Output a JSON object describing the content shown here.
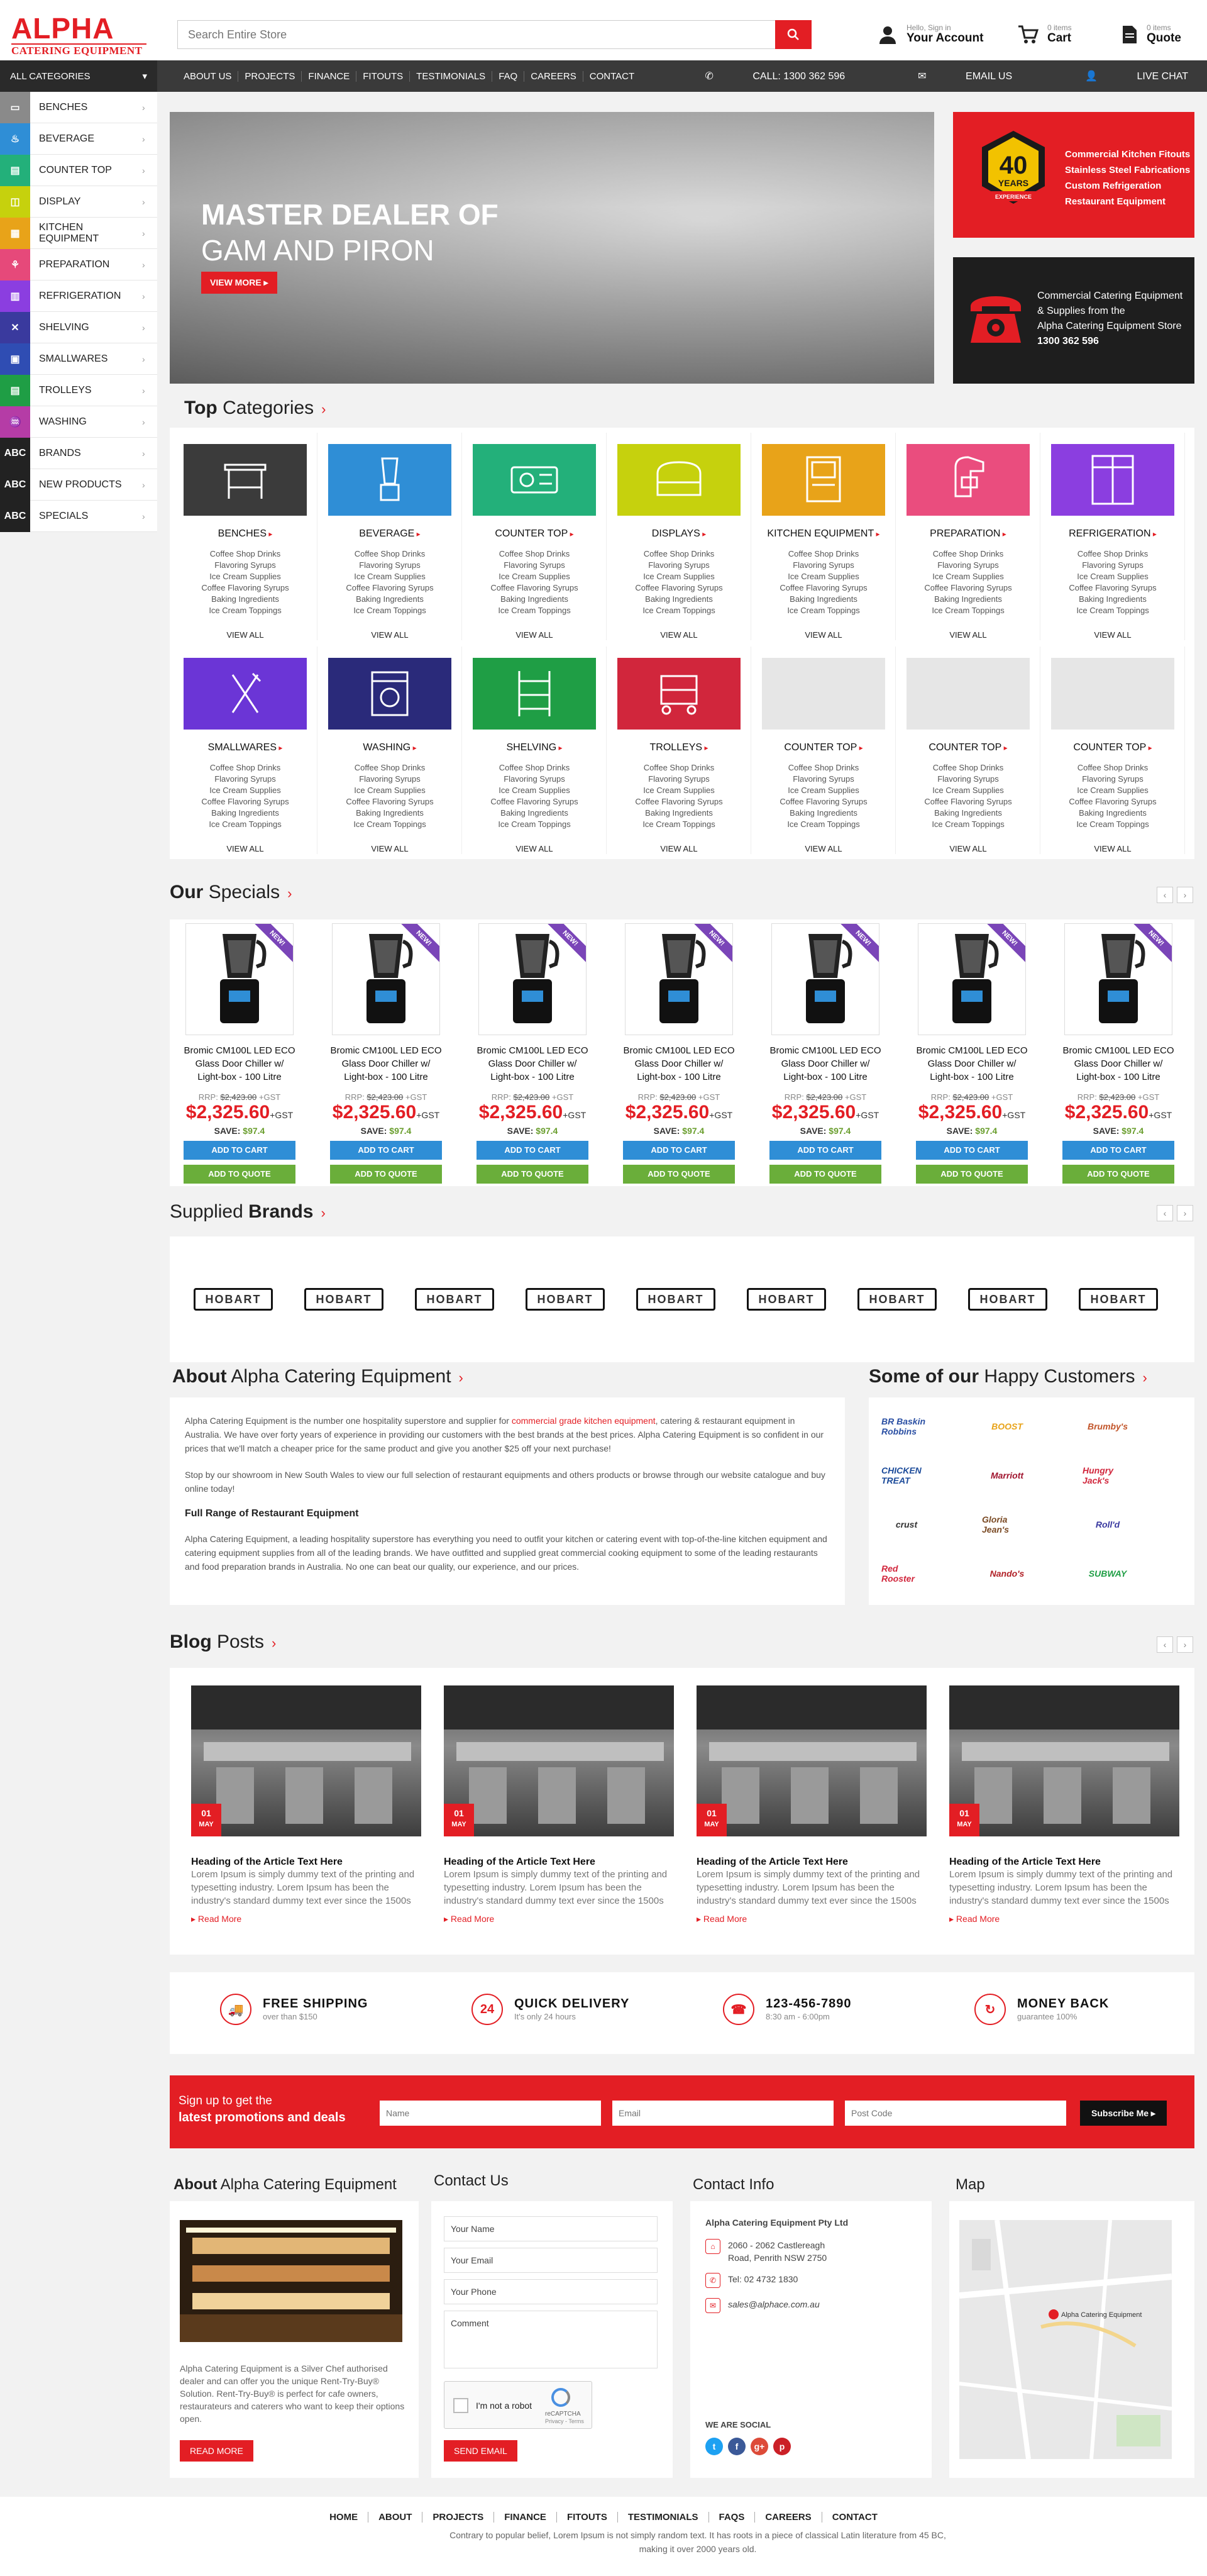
{
  "header": {
    "logo_top": "ALPHA",
    "logo_bottom": "CATERING EQUIPMENT",
    "search_placeholder": "Search Entire Store",
    "account_small": "Hello, Sign in",
    "account_label": "Your Account",
    "cart_small": "0 items",
    "cart_label": "Cart",
    "quote_small": "0 items",
    "quote_label": "Quote"
  },
  "nav": {
    "all_categories": "ALL CATEGORIES",
    "menu": [
      "ABOUT US",
      "PROJECTS",
      "FINANCE",
      "FITOUTS",
      "TESTIMONIALS",
      "FAQ",
      "CAREERS",
      "CONTACT"
    ],
    "call": "CALL: 1300 362 596",
    "email": "EMAIL US",
    "chat": "LIVE CHAT"
  },
  "sidebar": [
    {
      "label": "BENCHES",
      "color": "#8a8a8a",
      "icon": "bench-icon",
      "glyph": "▭"
    },
    {
      "label": "BEVERAGE",
      "color": "#2f8ed6",
      "icon": "beverage-icon",
      "glyph": "♨"
    },
    {
      "label": "COUNTER TOP",
      "color": "#23b07a",
      "icon": "counter-top-icon",
      "glyph": "▤"
    },
    {
      "label": "DISPLAY",
      "color": "#c6d10d",
      "icon": "display-icon",
      "glyph": "◫"
    },
    {
      "label": "KITCHEN EQUIPMENT",
      "color": "#e8a319",
      "icon": "kitchen-equipment-icon",
      "glyph": "▦"
    },
    {
      "label": "PREPARATION",
      "color": "#e6497a",
      "icon": "preparation-icon",
      "glyph": "⚘"
    },
    {
      "label": "REFRIGERATION",
      "color": "#8b3ee0",
      "icon": "refrigeration-icon",
      "glyph": "▥"
    },
    {
      "label": "SHELVING",
      "color": "#3a3a9e",
      "icon": "shelving-icon",
      "glyph": "✕"
    },
    {
      "label": "SMALLWARES",
      "color": "#2f4db3",
      "icon": "smallwares-icon",
      "glyph": "▣"
    },
    {
      "label": "TROLLEYS",
      "color": "#1f9e45",
      "icon": "trolleys-icon",
      "glyph": "▤"
    },
    {
      "label": "WASHING",
      "color": "#b53ca6",
      "icon": "washing-icon",
      "glyph": "♒"
    },
    {
      "label": "BRANDS",
      "color": "#222222",
      "icon": "brands-icon",
      "glyph": "ABC"
    },
    {
      "label": "NEW PRODUCTS",
      "color": "#222222",
      "icon": "new-products-icon",
      "glyph": "ABC"
    },
    {
      "label": "SPECIALS",
      "color": "#222222",
      "icon": "specials-icon",
      "glyph": "ABC"
    }
  ],
  "hero": {
    "line1": "MASTER DEALER OF",
    "line2": "GAM AND PIRON",
    "button": "VIEW MORE ▸"
  },
  "promo1": {
    "badge_num": "40",
    "badge_text": "YEARS",
    "badge_sub": "EXPERIENCE",
    "items": [
      "Commercial Kitchen Fitouts",
      "Stainless Steel Fabrications",
      "Custom Refrigeration",
      "Restaurant Equipment"
    ]
  },
  "promo2": {
    "line1": "Commercial Catering Equipment",
    "line2": "& Supplies from the",
    "line3": "Alpha Catering Equipment Store",
    "phone": "1300 362 596"
  },
  "top_categories": {
    "title_bold": "Top",
    "title_rest": "Categories",
    "sub_items": [
      "Coffee Shop Drinks",
      "Flavoring Syrups",
      "Ice Cream Supplies",
      "Coffee Flavoring Syrups",
      "Baking Ingredients",
      "Ice Cream Toppings"
    ],
    "view_all": "VIEW ALL",
    "items": [
      {
        "name": "BENCHES",
        "color": "#3b3b3b",
        "icon": "bench-icon"
      },
      {
        "name": "BEVERAGE",
        "color": "#2f8ed6",
        "icon": "blender-icon"
      },
      {
        "name": "COUNTER TOP",
        "color": "#23b07a",
        "icon": "counter-top-icon"
      },
      {
        "name": "DISPLAYS",
        "color": "#c6d10d",
        "icon": "display-case-icon"
      },
      {
        "name": "KITCHEN EQUIPMENT",
        "color": "#e8a319",
        "icon": "kitchen-equipment-icon"
      },
      {
        "name": "PREPARATION",
        "color": "#ea4d7e",
        "icon": "mixer-icon"
      },
      {
        "name": "REFRIGERATION",
        "color": "#8b3ee0",
        "icon": "fridge-icon"
      },
      {
        "name": "SMALLWARES",
        "color": "#6b35d6",
        "icon": "fork-knife-icon"
      },
      {
        "name": "WASHING",
        "color": "#2a2a7a",
        "icon": "dishwasher-icon"
      },
      {
        "name": "SHELVING",
        "color": "#1f9e45",
        "icon": "shelving-icon"
      },
      {
        "name": "TROLLEYS",
        "color": "#d1263c",
        "icon": "trolley-icon"
      },
      {
        "name": "COUNTER TOP",
        "color": "#e6e6e6",
        "icon": "placeholder-icon"
      },
      {
        "name": "COUNTER TOP",
        "color": "#e6e6e6",
        "icon": "placeholder-icon"
      },
      {
        "name": "COUNTER TOP",
        "color": "#e6e6e6",
        "icon": "placeholder-icon"
      }
    ]
  },
  "specials": {
    "title_bold": "Our",
    "title_rest": "Specials",
    "product": {
      "badge": "NEW!",
      "name": "Bromic CM100L LED ECO Glass Door Chiller w/ Light-box - 100 Litre",
      "rrp_label": "RRP:",
      "rrp": "$2,423.00",
      "rrp_gst": "+GST",
      "price": "$2,325.60",
      "price_gst": "+GST",
      "save_label": "SAVE:",
      "save": "$97.4",
      "add_cart": "ADD TO CART",
      "add_quote": "ADD TO QUOTE"
    },
    "count": 7
  },
  "brands": {
    "title_rest": "Supplied",
    "title_bold": "Brands",
    "logo": "HOBART",
    "count": 9
  },
  "about": {
    "title_bold": "About",
    "title_rest": "Alpha Catering Equipment",
    "p1_a": "Alpha Catering Equipment is the number one hospitality superstore and supplier for ",
    "p1_link": "commercial grade kitchen equipment",
    "p1_b": ", catering & restaurant equipment  in Australia. We have over forty years of experience in providing our customers with the best brands at the best prices. Alpha Catering Equipment is so confident in our prices that we'll match a cheaper price for the same product and give you another $25 off your next purchase!",
    "p2": "Stop by our showroom in New South Wales to view our full selection of restaurant equipments and others products or browse through our website catalogue and buy online today!",
    "h": "Full Range of Restaurant Equipment",
    "p3": "Alpha Catering Equipment, a leading hospitality superstore has everything you need to outfit your kitchen or catering event with top-of-the-line kitchen equipment and catering equipment supplies from all of the leading brands. We have outfitted and supplied great commercial cooking equipment to some of the leading restaurants and food preparation brands in Australia. No one can beat our quality, our experience, and our prices."
  },
  "customers": {
    "title_rest1": "Some of our",
    "title_rest2": "Happy Customers",
    "logos": [
      {
        "text": "BR Baskin Robbins",
        "color": "#2a4fa3"
      },
      {
        "text": "BOOST",
        "color": "#e8a319"
      },
      {
        "text": "Brumby's",
        "color": "#c2552a"
      },
      {
        "text": "CHICKEN TREAT",
        "color": "#1c4b9a"
      },
      {
        "text": "Marriott",
        "color": "#a0142e"
      },
      {
        "text": "Hungry Jack's",
        "color": "#d1263c"
      },
      {
        "text": "crust",
        "color": "#333333"
      },
      {
        "text": "Gloria Jean's",
        "color": "#7a4a24"
      },
      {
        "text": "Roll'd",
        "color": "#3a3aa0"
      },
      {
        "text": "Red Rooster",
        "color": "#d1263c"
      },
      {
        "text": "Nando's",
        "color": "#b01e24"
      },
      {
        "text": "SUBWAY",
        "color": "#1f9e45"
      }
    ]
  },
  "blog": {
    "title_bold": "Blog",
    "title_rest": "Posts",
    "post": {
      "day": "01",
      "month": "MAY",
      "heading": "Heading of the Article Text Here",
      "body": "Lorem Ipsum is simply dummy text of the printing and typesetting industry. Lorem Ipsum has been the industry's standard dummy text ever since the 1500s",
      "more": "▸  Read More"
    },
    "count": 4
  },
  "features": [
    {
      "title": "FREE SHIPPING",
      "sub": "over than $150",
      "icon": "shipping-icon",
      "glyph": "🚚"
    },
    {
      "title": "QUICK DELIVERY",
      "sub": "It's only 24 hours",
      "icon": "delivery-24-icon",
      "glyph": "24"
    },
    {
      "title": "123-456-7890",
      "sub": "8:30 am - 6:00pm",
      "icon": "phone-icon",
      "glyph": "☎"
    },
    {
      "title": "MONEY BACK",
      "sub": "guarantee 100%",
      "icon": "money-back-icon",
      "glyph": "↻"
    }
  ],
  "newsletter": {
    "line1": "Sign up to get the",
    "line2": "latest promotions and deals",
    "name_ph": "Name",
    "email_ph": "Email",
    "post_ph": "Post Code",
    "button": "Subscribe Me ▸"
  },
  "footer_about": {
    "title_bold": "About",
    "title_rest": "Alpha Catering Equipment",
    "text": "Alpha Catering Equipment is a Silver Chef authorised dealer and can offer you the unique Rent-Try-Buy® Solution. Rent-Try-Buy® is perfect for cafe owners, restaurateurs and caterers who want to keep their options open.",
    "button": "READ MORE"
  },
  "contact": {
    "title": "Contact Us",
    "fields": [
      "Your Name",
      "Your Email",
      "Your Phone",
      "Comment"
    ],
    "captcha": "I'm not a robot",
    "captcha_brand": "reCAPTCHA",
    "captcha_terms": "Privacy - Terms",
    "button": "SEND EMAIL"
  },
  "contact_info": {
    "title": "Contact Info",
    "company": "Alpha Catering Equipment Pty Ltd",
    "addr1": "2060 - 2062 Castlereagh",
    "addr2": "Road, Penrith NSW 2750",
    "tel": "Tel: 02 4732 1830",
    "email": "sales@alphace.com.au",
    "social_label": "WE ARE SOCIAL",
    "social": [
      {
        "glyph": "t",
        "color": "#1da1f2",
        "icon": "twitter-icon"
      },
      {
        "glyph": "f",
        "color": "#3b5998",
        "icon": "facebook-icon"
      },
      {
        "glyph": "g+",
        "color": "#dd4b39",
        "icon": "google-plus-icon"
      },
      {
        "glyph": "p",
        "color": "#cb2027",
        "icon": "pinterest-icon"
      }
    ]
  },
  "map": {
    "title": "Map",
    "marker_label": "Alpha Catering Equipment"
  },
  "footer": {
    "menu": [
      "HOME",
      "ABOUT",
      "PROJECTS",
      "FINANCE",
      "FITOUTS",
      "TESTIMONIALS",
      "FAQS",
      "CAREERS",
      "CONTACT"
    ],
    "text": "Contrary to popular belief, Lorem Ipsum is not simply random text. It has roots in a piece of classical Latin literature from 45 BC, making it over 2000 years old."
  }
}
